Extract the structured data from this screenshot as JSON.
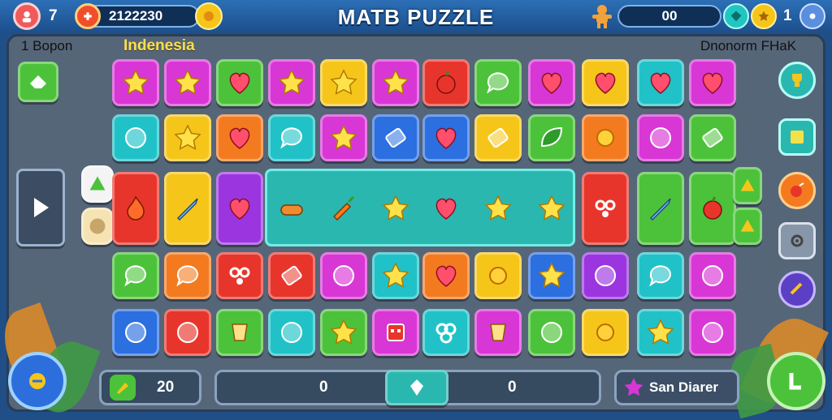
{
  "header": {
    "lives": "7",
    "score": "2122230",
    "title": "MATB PUZZLE",
    "coins": "00",
    "level": "1"
  },
  "board": {
    "top_left_label": "1 Bopon",
    "region_label": "Indenesia",
    "top_right_label": "Dnonorm FHaK"
  },
  "footer": {
    "moves_value": "20",
    "progress_left_value": "0",
    "progress_right_value": "0",
    "action_label": "San Diarer"
  },
  "colors": {
    "red": "#e8352b",
    "orange": "#f47a1f",
    "yellow": "#f6c51a",
    "green": "#4cc23a",
    "teal": "#20c2c8",
    "blue": "#2b6fe0",
    "purple": "#9b35e0",
    "magenta": "#d936d6"
  },
  "grid": {
    "rows": [
      [
        {
          "color": "magenta",
          "icon": "star-icon"
        },
        {
          "color": "magenta",
          "icon": "star-icon"
        },
        {
          "color": "green",
          "icon": "heart-icon"
        },
        {
          "color": "magenta",
          "icon": "star-icon"
        },
        {
          "color": "yellow",
          "icon": "star-icon"
        },
        {
          "color": "magenta",
          "icon": "star-icon"
        },
        {
          "color": "red",
          "icon": "apple-icon"
        },
        {
          "color": "green",
          "icon": "bubble-icon"
        },
        {
          "color": "magenta",
          "icon": "heart-icon"
        },
        {
          "color": "yellow",
          "icon": "heart-icon"
        },
        {
          "color": "teal",
          "icon": "heart-icon"
        },
        {
          "color": "magenta",
          "icon": "heart-icon"
        }
      ],
      [
        {
          "color": "teal",
          "icon": "circle-icon"
        },
        {
          "color": "yellow",
          "icon": "star-icon"
        },
        {
          "color": "orange",
          "icon": "heart-icon"
        },
        {
          "color": "teal",
          "icon": "bubble-icon"
        },
        {
          "color": "magenta",
          "icon": "star-icon"
        },
        {
          "color": "blue",
          "icon": "bar-icon"
        },
        {
          "color": "blue",
          "icon": "heart-icon"
        },
        {
          "color": "yellow",
          "icon": "bar-icon"
        },
        {
          "color": "green",
          "icon": "leaf-icon"
        },
        {
          "color": "orange",
          "icon": "sun-icon"
        },
        {
          "color": "magenta",
          "icon": "circle-icon"
        },
        {
          "color": "green",
          "icon": "bar-icon"
        }
      ],
      [
        {
          "color": "red",
          "icon": "fire-icon"
        },
        {
          "color": "yellow",
          "icon": "sword-icon"
        },
        {
          "color": "purple",
          "icon": "heart-icon"
        },
        {
          "color": "teal",
          "icon": "bread-icon"
        },
        {
          "color": "teal",
          "icon": "carrot-icon"
        },
        {
          "color": "teal",
          "icon": "star-icon"
        },
        {
          "color": "teal",
          "icon": "heart-icon"
        },
        {
          "color": "purple",
          "icon": "star-icon"
        },
        {
          "color": "purple",
          "icon": "star-icon"
        },
        {
          "color": "red",
          "icon": "swirl-icon"
        },
        {
          "color": "green",
          "icon": "sword-icon"
        },
        {
          "color": "green",
          "icon": "apple-icon"
        }
      ],
      [
        {
          "color": "green",
          "icon": "bubble-icon"
        },
        {
          "color": "orange",
          "icon": "bubble-icon"
        },
        {
          "color": "red",
          "icon": "swirl-icon"
        },
        {
          "color": "red",
          "icon": "bar-icon"
        },
        {
          "color": "magenta",
          "icon": "circle-icon"
        },
        {
          "color": "teal",
          "icon": "star-icon"
        },
        {
          "color": "orange",
          "icon": "heart-icon"
        },
        {
          "color": "yellow",
          "icon": "sun-icon"
        },
        {
          "color": "blue",
          "icon": "star-icon"
        },
        {
          "color": "purple",
          "icon": "circle-icon"
        },
        {
          "color": "teal",
          "icon": "bubble-icon"
        },
        {
          "color": "magenta",
          "icon": "circle-icon"
        }
      ],
      [
        {
          "color": "blue",
          "icon": "circle-icon"
        },
        {
          "color": "red",
          "icon": "circle-icon"
        },
        {
          "color": "green",
          "icon": "cup-icon"
        },
        {
          "color": "teal",
          "icon": "circle-icon"
        },
        {
          "color": "green",
          "icon": "star-icon"
        },
        {
          "color": "magenta",
          "icon": "robot-icon"
        },
        {
          "color": "teal",
          "icon": "flower-icon"
        },
        {
          "color": "magenta",
          "icon": "cup-icon"
        },
        {
          "color": "green",
          "icon": "circle-icon"
        },
        {
          "color": "yellow",
          "icon": "sun-icon"
        },
        {
          "color": "teal",
          "icon": "star-icon"
        },
        {
          "color": "magenta",
          "icon": "circle-icon"
        }
      ]
    ]
  },
  "side_buttons_right": [
    "trophy-icon",
    "note-icon",
    "bomb-icon",
    "settings-icon",
    "shuffle-icon"
  ]
}
